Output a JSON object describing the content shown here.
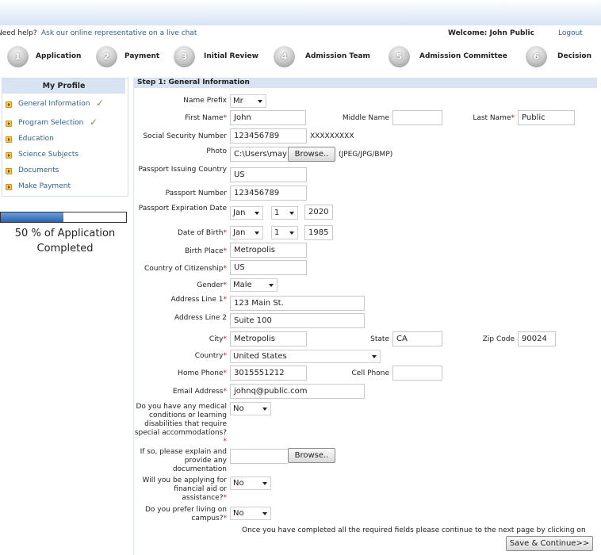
{
  "header": {
    "help_prefix": "Need help?",
    "help_link": "Ask our online representative on a live chat",
    "welcome": "Welcome: John Public",
    "logout": "Logout"
  },
  "steps": [
    {
      "num": "1",
      "label": "Application"
    },
    {
      "num": "2",
      "label": "Payment"
    },
    {
      "num": "3",
      "label": "Initial Review"
    },
    {
      "num": "4",
      "label": "Admission Team"
    },
    {
      "num": "5",
      "label": "Admission Committee"
    },
    {
      "num": "6",
      "label": "Decision"
    }
  ],
  "sidebar": {
    "title": "My Profile",
    "items": [
      {
        "label": "General Information",
        "completed": true
      },
      {
        "label": "Program Selection",
        "completed": true
      },
      {
        "label": "Education",
        "completed": false
      },
      {
        "label": "Science Subjects",
        "completed": false
      },
      {
        "label": "Documents",
        "completed": false
      },
      {
        "label": "Make Payment",
        "completed": false
      }
    ],
    "check_glyph": "✓",
    "progress_percent": 50,
    "progress_text": "50 % of Application Completed"
  },
  "form": {
    "section_title": "Step 1: General Information",
    "name_prefix": {
      "label": "Name Prefix",
      "value": "Mr"
    },
    "first_name": {
      "label": "First Name",
      "value": "John"
    },
    "middle_name": {
      "label": "Middle Name",
      "value": ""
    },
    "last_name": {
      "label": "Last Name",
      "value": "Public"
    },
    "ssn": {
      "label": "Social Security Number",
      "value": "123456789",
      "mask": "XXXXXXXXX"
    },
    "photo": {
      "label": "Photo",
      "value": "C:\\Users\\may",
      "button": "Browse..",
      "hint": "(JPEG/JPG/BMP)"
    },
    "passport_country": {
      "label": "Passport Issuing Country",
      "value": "US"
    },
    "passport_number": {
      "label": "Passport Number",
      "value": "123456789"
    },
    "passport_expiration": {
      "label": "Passport Expiration Date",
      "month": "Jan",
      "day": "1",
      "year": "2020"
    },
    "dob": {
      "label": "Date of Birth",
      "month": "Jan",
      "day": "1",
      "year": "1985"
    },
    "birth_place": {
      "label": "Birth Place",
      "value": "Metropolis"
    },
    "citizenship": {
      "label": "Country of Citizenship",
      "value": "US"
    },
    "gender": {
      "label": "Gender",
      "value": "Male"
    },
    "address1": {
      "label": "Address Line 1",
      "value": "123 Main St."
    },
    "address2": {
      "label": "Address Line 2",
      "value": "Suite 100"
    },
    "city": {
      "label": "City",
      "value": "Metropolis"
    },
    "state": {
      "label": "State",
      "value": "CA"
    },
    "zip": {
      "label": "Zip Code",
      "value": "90024"
    },
    "country": {
      "label": "Country",
      "value": "United States"
    },
    "home_phone": {
      "label": "Home Phone",
      "value": "3015551212"
    },
    "cell_phone": {
      "label": "Cell Phone",
      "value": ""
    },
    "email": {
      "label": "Email Address",
      "value": "johnq@public.com"
    },
    "medical": {
      "label": "Do you have any medical conditions or learning disabilities that require special accommodations?",
      "value": "No"
    },
    "explain": {
      "label": "If so, please explain and provide any documentation",
      "value": "",
      "button": "Browse.."
    },
    "financial_aid": {
      "label": "Will you be applying for financial aid or assistance?",
      "value": "No"
    },
    "campus": {
      "label": "Do you prefer living on campus?",
      "value": "No"
    },
    "footer_note": "Once you have completed all the required fields please continue to the next page by clicking on",
    "save_button": "Save & Continue>>"
  },
  "colors": {
    "link": "#2e5f97",
    "required": "#dd1111",
    "section_bg": "#d8e4f2",
    "progress": "#2c64b0",
    "check": "#6ca534"
  }
}
